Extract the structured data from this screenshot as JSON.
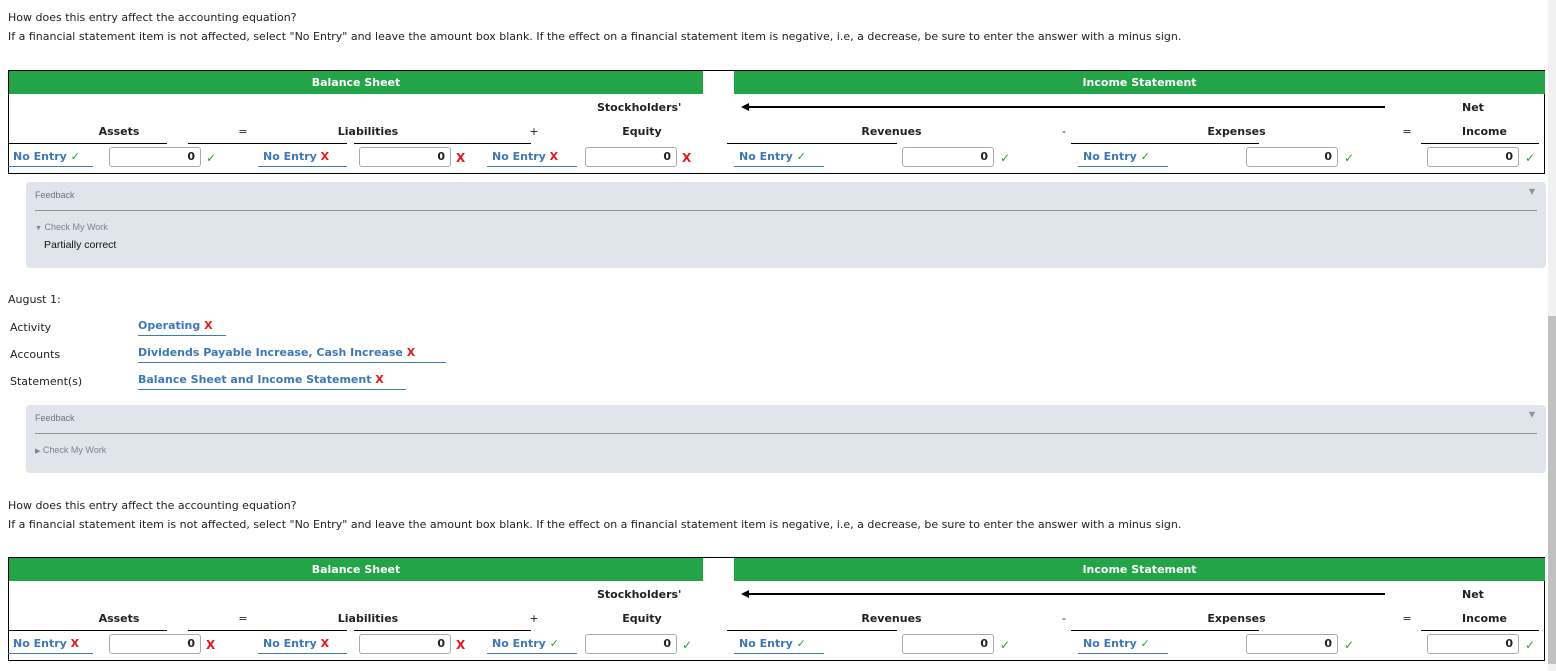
{
  "question1": {
    "line1": "How does this entry affect the accounting equation?",
    "line2": "If a financial statement item is not affected, select \"No Entry\" and leave the amount box blank. If the effect on a financial statement item is negative, i.e, a decrease, be sure to enter the answer with a minus sign."
  },
  "table_headers": {
    "balance_sheet": "Balance Sheet",
    "income_statement": "Income Statement",
    "assets": "Assets",
    "liabilities": "Liabilities",
    "stockholders": "Stockholders'",
    "equity": "Equity",
    "revenues": "Revenues",
    "expenses": "Expenses",
    "net": "Net",
    "income": "Income",
    "op_equals": "=",
    "op_plus": "+",
    "op_minus": "-"
  },
  "table1": {
    "assets": {
      "select": "No Entry",
      "select_status": "correct",
      "amount": "0",
      "amount_status": "correct"
    },
    "liabilities": {
      "select": "No Entry",
      "select_status": "incorrect",
      "amount": "0",
      "amount_status": "incorrect"
    },
    "equity": {
      "select": "No Entry",
      "select_status": "incorrect",
      "amount": "0",
      "amount_status": "incorrect"
    },
    "revenues": {
      "select": "No Entry",
      "select_status": "correct",
      "amount": "0",
      "amount_status": "correct"
    },
    "expenses": {
      "select": "No Entry",
      "select_status": "correct",
      "amount": "0",
      "amount_status": "correct"
    },
    "net_income": {
      "amount": "0",
      "amount_status": "correct"
    }
  },
  "feedback1": {
    "title": "Feedback",
    "check_label": "Check My Work",
    "expanded": true,
    "message": "Partially correct"
  },
  "transaction": {
    "date": "August 1:",
    "rows": [
      {
        "label": "Activity",
        "value": "Operating",
        "status": "incorrect"
      },
      {
        "label": "Accounts",
        "value": "Dividends Payable Increase, Cash Increase",
        "status": "incorrect"
      },
      {
        "label": "Statement(s)",
        "value": "Balance Sheet and Income Statement",
        "status": "incorrect"
      }
    ]
  },
  "feedback2": {
    "title": "Feedback",
    "check_label": "Check My Work",
    "expanded": false
  },
  "question2": {
    "line1": "How does this entry affect the accounting equation?",
    "line2": "If a financial statement item is not affected, select \"No Entry\" and leave the amount box blank. If the effect on a financial statement item is negative, i.e, a decrease, be sure to enter the answer with a minus sign."
  },
  "table2": {
    "assets": {
      "select": "No Entry",
      "select_status": "incorrect",
      "amount": "0",
      "amount_status": "incorrect"
    },
    "liabilities": {
      "select": "No Entry",
      "select_status": "incorrect",
      "amount": "0",
      "amount_status": "incorrect"
    },
    "equity": {
      "select": "No Entry",
      "select_status": "correct",
      "amount": "0",
      "amount_status": "correct"
    },
    "revenues": {
      "select": "No Entry",
      "select_status": "correct",
      "amount": "0",
      "amount_status": "correct"
    },
    "expenses": {
      "select": "No Entry",
      "select_status": "correct",
      "amount": "0",
      "amount_status": "correct"
    },
    "net_income": {
      "amount": "0",
      "amount_status": "correct"
    }
  },
  "icons": {
    "correct": "✓",
    "incorrect": "X",
    "expanded": "▼",
    "collapsed": "▶",
    "panel_toggle": "▼"
  },
  "colors": {
    "header_green": "#22a447",
    "link_blue": "#3d78b8",
    "correct_green": "#2e9e3a",
    "incorrect_red": "#e8161b",
    "feedback_bg": "#dfe5ea"
  }
}
